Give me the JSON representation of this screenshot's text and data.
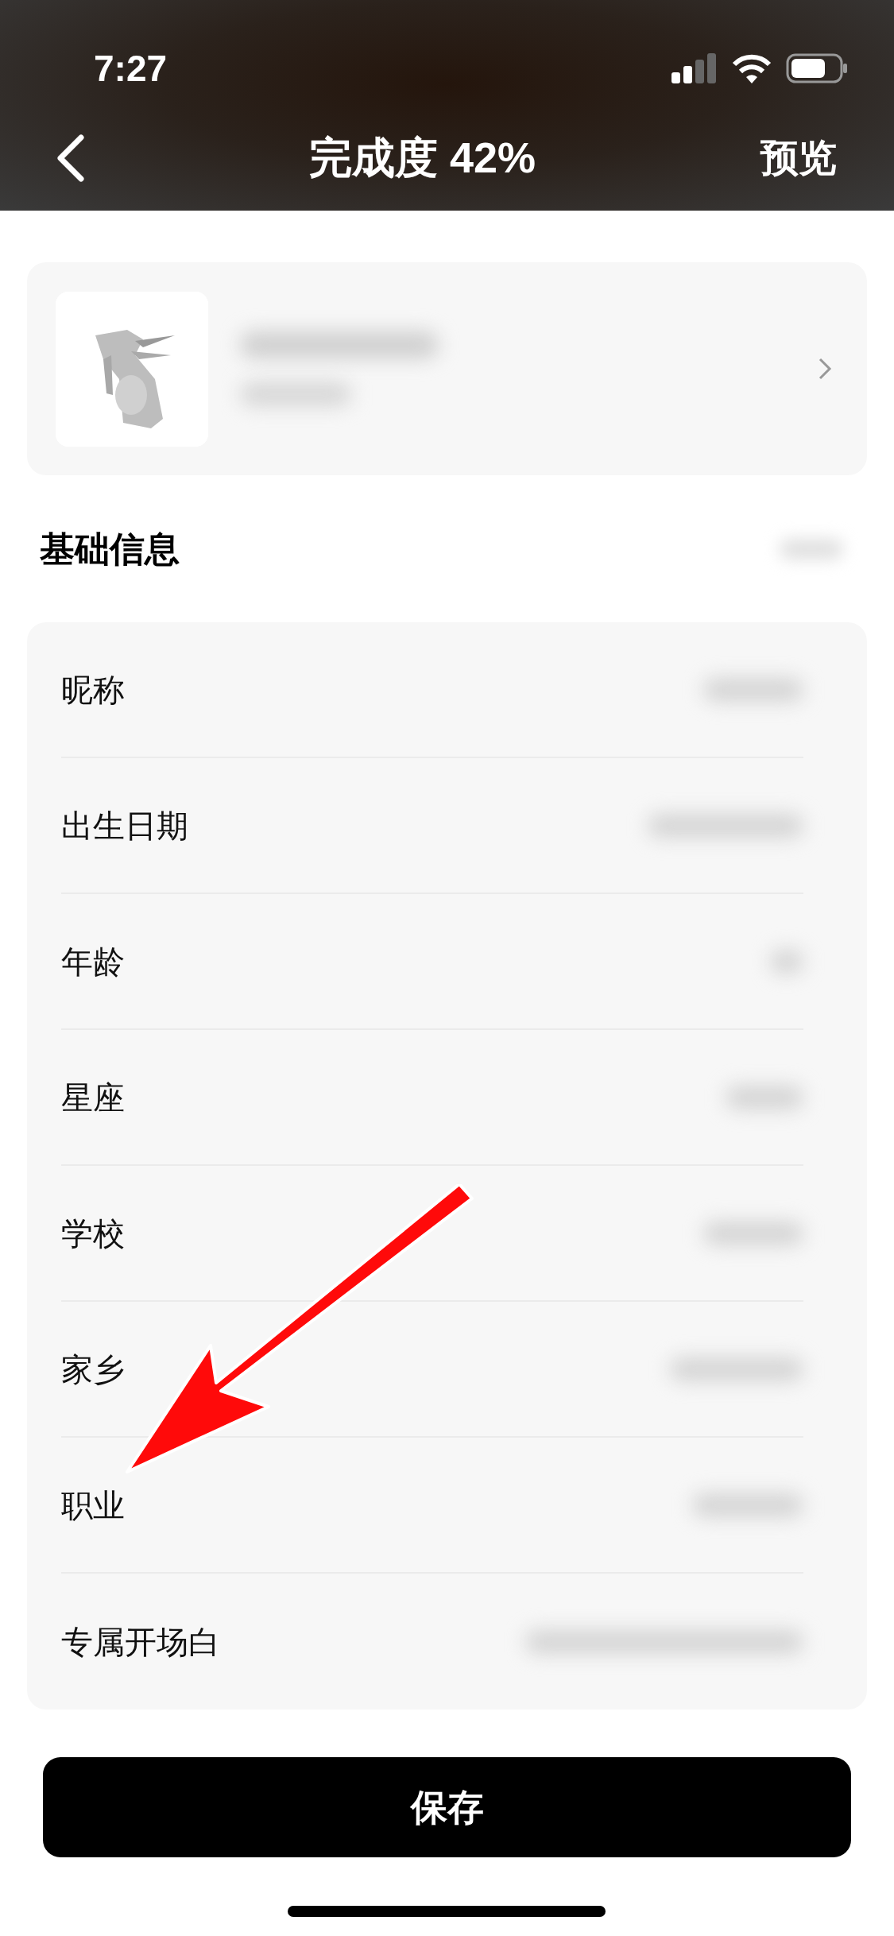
{
  "status_bar": {
    "time": "7:27"
  },
  "nav": {
    "title": "完成度 42%",
    "action": "预览"
  },
  "section": {
    "title": "基础信息"
  },
  "fields": [
    {
      "label": "昵称"
    },
    {
      "label": "出生日期"
    },
    {
      "label": "年龄"
    },
    {
      "label": "星座"
    },
    {
      "label": "学校"
    },
    {
      "label": "家乡"
    },
    {
      "label": "职业"
    },
    {
      "label": "专属开场白"
    }
  ],
  "save_button": "保存"
}
